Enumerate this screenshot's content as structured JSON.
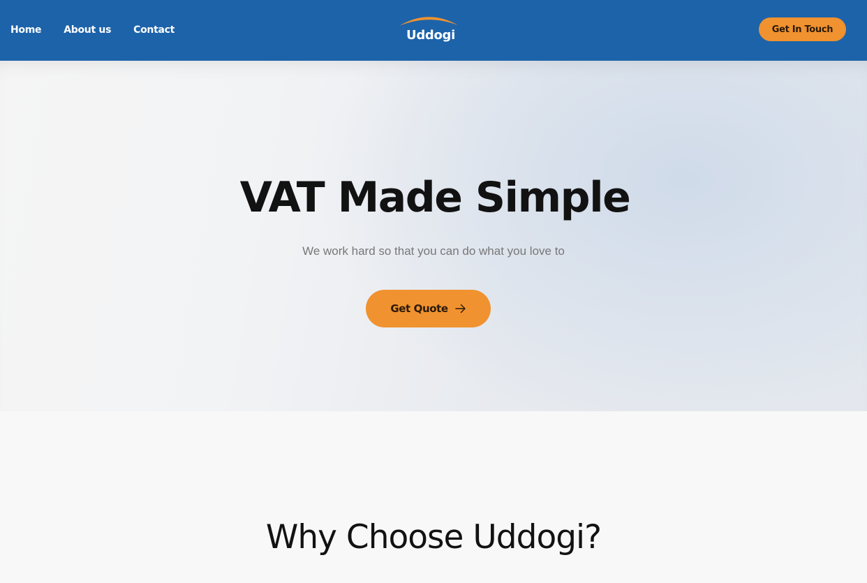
{
  "nav": {
    "links": [
      {
        "label": "Home"
      },
      {
        "label": "About us"
      },
      {
        "label": "Contact"
      }
    ],
    "logo_text": "Uddogi",
    "cta_label": "Get In Touch"
  },
  "hero": {
    "title": "VAT Made Simple",
    "subtitle": "We work hard so that you can do what you love to",
    "quote_button_label": "Get Quote",
    "quote_button_icon": "arrow-right-icon"
  },
  "why": {
    "title": "Why Choose Uddogi?"
  },
  "colors": {
    "nav_background": "#1d63aa",
    "accent": "#f0922f",
    "text_dark": "#121212",
    "text_muted": "#777777",
    "page_background": "#f8f8f8"
  }
}
